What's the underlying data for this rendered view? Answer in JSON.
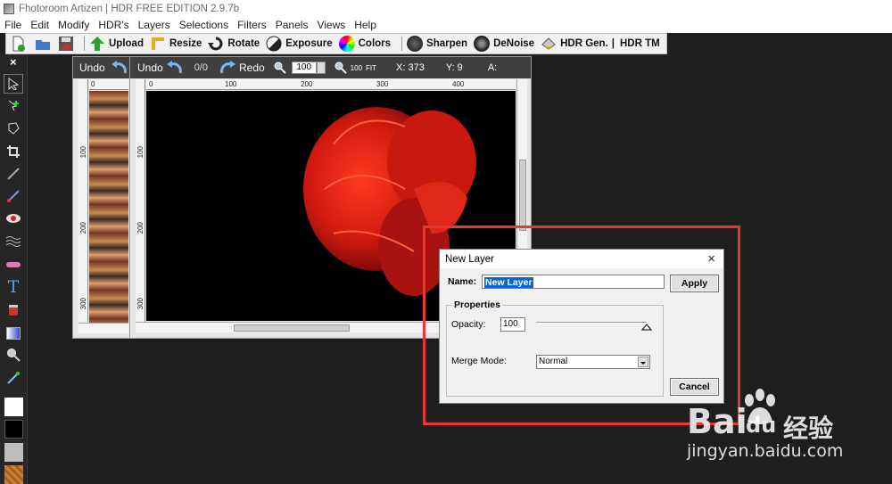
{
  "window": {
    "title": "Fhotoroom Artizen | HDR FREE EDITION 2.9.7b"
  },
  "menu": [
    "File",
    "Edit",
    "Modify",
    "HDR's",
    "Layers",
    "Selections",
    "Filters",
    "Panels",
    "Views",
    "Help"
  ],
  "toolbar": {
    "upload": "Upload",
    "resize": "Resize",
    "rotate": "Rotate",
    "exposure": "Exposure",
    "colors": "Colors",
    "sharpen": "Sharpen",
    "denoise": "DeNoise",
    "hdr_gen": "HDR Gen.",
    "sep": "|",
    "hdr_tm": "HDR TM"
  },
  "palette": {
    "close": "×"
  },
  "nav_window": {
    "undo": "Undo",
    "ruler_top": "0",
    "ruler_left": [
      "100",
      "200",
      "300"
    ]
  },
  "main_window": {
    "undo": "Undo",
    "history": "0/0",
    "redo": "Redo",
    "zoom": "100",
    "zoom_pct": "100",
    "fit": "FIT",
    "x_label": "X: 373",
    "y_label": "Y: 9",
    "a_label": "A:",
    "ruler_top": [
      "0",
      "100",
      "200",
      "300",
      "400"
    ],
    "ruler_left": [
      "100",
      "200",
      "300"
    ]
  },
  "dialog": {
    "title": "New Layer",
    "name_label": "Name:",
    "name_value": "New Layer",
    "apply": "Apply",
    "properties": "Properties",
    "opacity_label": "Opacity:",
    "opacity_value": "100",
    "merge_label": "Merge Mode:",
    "merge_value": "Normal",
    "cancel": "Cancel",
    "close": "×"
  },
  "watermark": {
    "brand": "Bai",
    "brand2": "du",
    "cn": "经验",
    "url": "jingyan.baidu.com"
  },
  "colors": {
    "annotation": "#e53935",
    "dark_bg": "#1e1e1e"
  }
}
